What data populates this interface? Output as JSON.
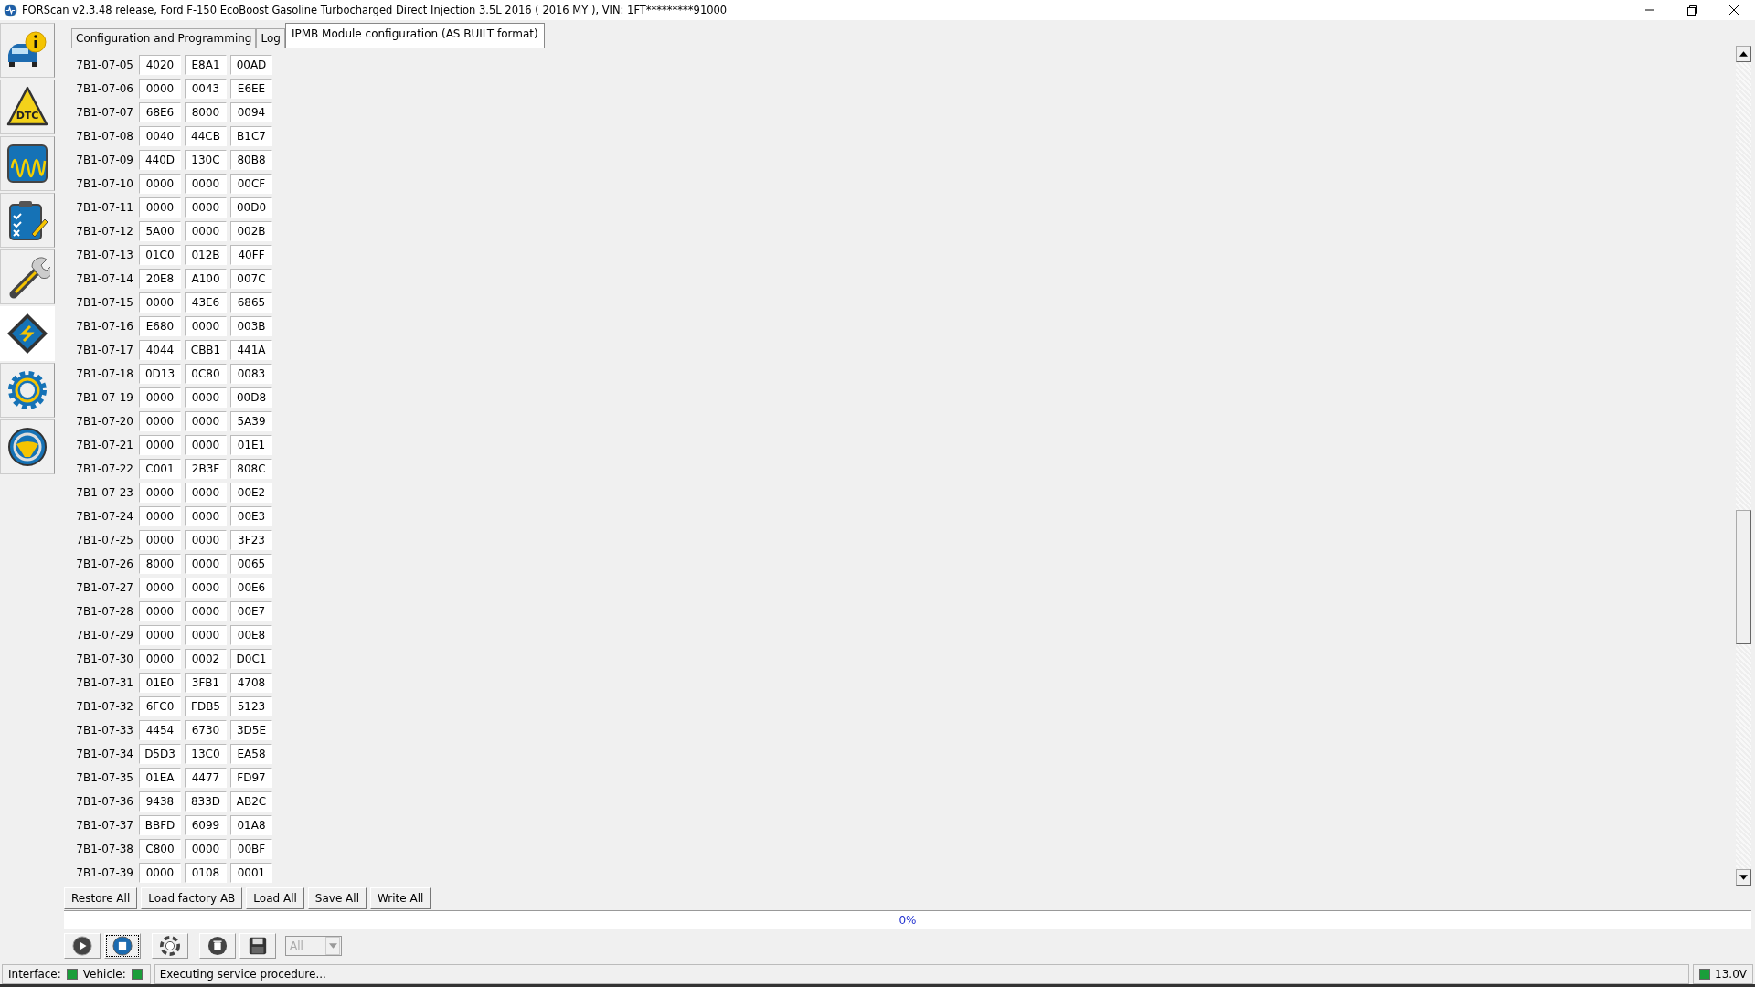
{
  "window": {
    "title": "FORScan v2.3.48 release, Ford F-150 EcoBoost Gasoline Turbocharged Direct Injection 3.5L 2016 ( 2016 MY ), VIN: 1FT*********91000"
  },
  "sidebar": {
    "items": [
      {
        "kind": "info",
        "selected": false
      },
      {
        "kind": "dtc",
        "text": "DTC",
        "selected": false
      },
      {
        "kind": "scope",
        "selected": false
      },
      {
        "kind": "checklist",
        "selected": false
      },
      {
        "kind": "wrench",
        "selected": false
      },
      {
        "kind": "chip",
        "selected": true
      },
      {
        "kind": "gear",
        "selected": false
      },
      {
        "kind": "help",
        "selected": false
      }
    ]
  },
  "tabs": [
    {
      "label": "Configuration and Programming",
      "selected": false
    },
    {
      "label": "Log",
      "selected": false
    },
    {
      "label": "IPMB Module configuration (AS BUILT format)",
      "selected": true
    }
  ],
  "table": {
    "rows": [
      {
        "address": "7B1-07-05",
        "values": [
          "4020",
          "E8A1",
          "00AD"
        ]
      },
      {
        "address": "7B1-07-06",
        "values": [
          "0000",
          "0043",
          "E6EE"
        ]
      },
      {
        "address": "7B1-07-07",
        "values": [
          "68E6",
          "8000",
          "0094"
        ]
      },
      {
        "address": "7B1-07-08",
        "values": [
          "0040",
          "44CB",
          "B1C7"
        ]
      },
      {
        "address": "7B1-07-09",
        "values": [
          "440D",
          "130C",
          "80B8"
        ]
      },
      {
        "address": "7B1-07-10",
        "values": [
          "0000",
          "0000",
          "00CF"
        ]
      },
      {
        "address": "7B1-07-11",
        "values": [
          "0000",
          "0000",
          "00D0"
        ]
      },
      {
        "address": "7B1-07-12",
        "values": [
          "5A00",
          "0000",
          "002B"
        ]
      },
      {
        "address": "7B1-07-13",
        "values": [
          "01C0",
          "012B",
          "40FF"
        ]
      },
      {
        "address": "7B1-07-14",
        "values": [
          "20E8",
          "A100",
          "007C"
        ]
      },
      {
        "address": "7B1-07-15",
        "values": [
          "0000",
          "43E6",
          "6865"
        ]
      },
      {
        "address": "7B1-07-16",
        "values": [
          "E680",
          "0000",
          "003B"
        ]
      },
      {
        "address": "7B1-07-17",
        "values": [
          "4044",
          "CBB1",
          "441A"
        ]
      },
      {
        "address": "7B1-07-18",
        "values": [
          "0D13",
          "0C80",
          "0083"
        ]
      },
      {
        "address": "7B1-07-19",
        "values": [
          "0000",
          "0000",
          "00D8"
        ]
      },
      {
        "address": "7B1-07-20",
        "values": [
          "0000",
          "0000",
          "5A39"
        ]
      },
      {
        "address": "7B1-07-21",
        "values": [
          "0000",
          "0000",
          "01E1"
        ]
      },
      {
        "address": "7B1-07-22",
        "values": [
          "C001",
          "2B3F",
          "808C"
        ]
      },
      {
        "address": "7B1-07-23",
        "values": [
          "0000",
          "0000",
          "00E2"
        ]
      },
      {
        "address": "7B1-07-24",
        "values": [
          "0000",
          "0000",
          "00E3"
        ]
      },
      {
        "address": "7B1-07-25",
        "values": [
          "0000",
          "0000",
          "3F23"
        ]
      },
      {
        "address": "7B1-07-26",
        "values": [
          "8000",
          "0000",
          "0065"
        ]
      },
      {
        "address": "7B1-07-27",
        "values": [
          "0000",
          "0000",
          "00E6"
        ]
      },
      {
        "address": "7B1-07-28",
        "values": [
          "0000",
          "0000",
          "00E7"
        ]
      },
      {
        "address": "7B1-07-29",
        "values": [
          "0000",
          "0000",
          "00E8"
        ]
      },
      {
        "address": "7B1-07-30",
        "values": [
          "0000",
          "0002",
          "D0C1"
        ]
      },
      {
        "address": "7B1-07-31",
        "values": [
          "01E0",
          "3FB1",
          "4708"
        ]
      },
      {
        "address": "7B1-07-32",
        "values": [
          "6FC0",
          "FDB5",
          "5123"
        ]
      },
      {
        "address": "7B1-07-33",
        "values": [
          "4454",
          "6730",
          "3D5E"
        ]
      },
      {
        "address": "7B1-07-34",
        "values": [
          "D5D3",
          "13C0",
          "EA58"
        ]
      },
      {
        "address": "7B1-07-35",
        "values": [
          "01EA",
          "4477",
          "FD97"
        ]
      },
      {
        "address": "7B1-07-36",
        "values": [
          "9438",
          "833D",
          "AB2C"
        ]
      },
      {
        "address": "7B1-07-37",
        "values": [
          "BBFD",
          "6099",
          "01A8"
        ]
      },
      {
        "address": "7B1-07-38",
        "values": [
          "C800",
          "0000",
          "00BF"
        ]
      },
      {
        "address": "7B1-07-39",
        "values": [
          "0000",
          "0108",
          "0001"
        ]
      }
    ]
  },
  "buttons": [
    "Restore All",
    "Load factory AB",
    "Load All",
    "Save All",
    "Write All"
  ],
  "progress": {
    "level": 0,
    "text": "0%"
  },
  "toolbar": {
    "tools": [
      {
        "kind": "play",
        "focused": false
      },
      {
        "kind": "stop",
        "focused": true
      },
      {
        "kind": "help",
        "focused": false
      },
      {
        "kind": "delete",
        "focused": false
      },
      {
        "kind": "save",
        "focused": false
      }
    ],
    "filter": {
      "value": "All",
      "disabled": true
    }
  },
  "status_bar": {
    "indicators": [
      {
        "label": "Interface:",
        "color": "#1a9e3a"
      },
      {
        "label": "Vehicle:",
        "color": "#1a9e3a"
      }
    ],
    "message": "Executing service procedure...",
    "voltage": {
      "text": "13.0V",
      "color": "#1a9e3a"
    }
  }
}
